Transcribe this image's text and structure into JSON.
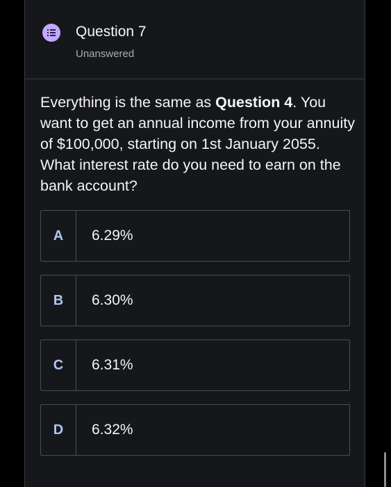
{
  "question": {
    "title": "Question 7",
    "status": "Unanswered",
    "icon": "list-icon",
    "text_part1": "Everything is the same as ",
    "text_bold": "Question 4",
    "text_part2": ".  You want to get an annual income from your annuity of $100,000, starting on 1st January 2055.  What interest rate do you need to earn on the bank account?"
  },
  "options": [
    {
      "letter": "A",
      "value": "6.29%"
    },
    {
      "letter": "B",
      "value": "6.30%"
    },
    {
      "letter": "C",
      "value": "6.31%"
    },
    {
      "letter": "D",
      "value": "6.32%"
    }
  ],
  "colors": {
    "background": "#000000",
    "panel": "#16171b",
    "icon_accent": "#c3a8ff",
    "option_letter": "#aec6f2"
  }
}
